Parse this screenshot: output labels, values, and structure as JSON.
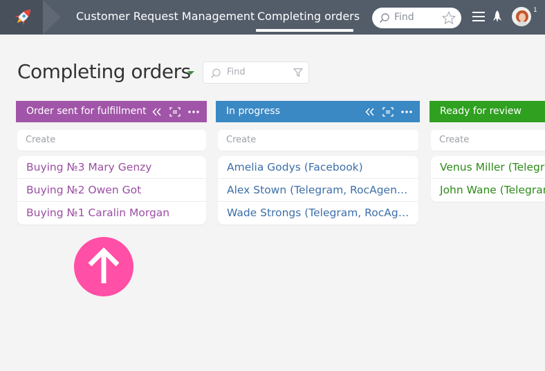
{
  "topbar": {
    "tabs": [
      {
        "label": "Customer Request Management",
        "active": false
      },
      {
        "label": "Completing orders",
        "active": true
      }
    ],
    "search_placeholder": "Find",
    "notification_count": "1",
    "icons": [
      "rocket-logo-icon",
      "search-icon",
      "star-icon",
      "menu-icon",
      "rocket-icon",
      "avatar"
    ]
  },
  "header": {
    "title": "Completing orders",
    "filter_placeholder": "Find",
    "icons": [
      "caret-down-icon",
      "search-icon",
      "funnel-icon"
    ]
  },
  "columns": [
    {
      "title": "Order sent for fulfillment",
      "color": "#a155a8",
      "create_label": "Create",
      "cards": [
        "Buying №3 Mary Genzy",
        "Buying №2 Owen Got",
        "Buying №1 Caralin Morgan"
      ]
    },
    {
      "title": "In progress",
      "color": "#3a88c4",
      "create_label": "Create",
      "cards": [
        "Amelia Godys (Facebook)",
        "Alex Stown (Telegram, RocAgency)",
        "Wade Strongs (Telegram, RocAgency)"
      ]
    },
    {
      "title": "Ready for review",
      "color": "#2fa01f",
      "create_label": "Create",
      "cards": [
        "Venus Miller (Telegram)",
        "John Wane (Telegram)"
      ]
    }
  ],
  "fab": {
    "icon": "arrow-up-icon",
    "color": "#ff4fa6"
  }
}
